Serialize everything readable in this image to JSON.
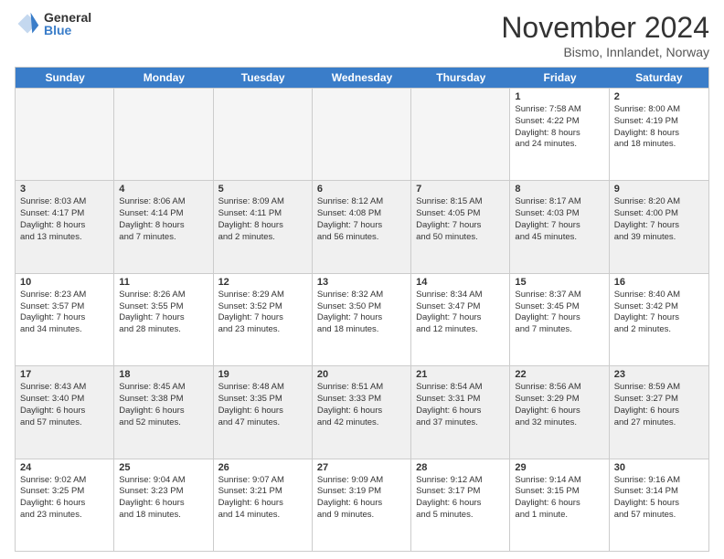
{
  "logo": {
    "general": "General",
    "blue": "Blue"
  },
  "title": "November 2024",
  "location": "Bismo, Innlandet, Norway",
  "days_header": [
    "Sunday",
    "Monday",
    "Tuesday",
    "Wednesday",
    "Thursday",
    "Friday",
    "Saturday"
  ],
  "rows": [
    [
      {
        "day": "",
        "info": "",
        "empty": true
      },
      {
        "day": "",
        "info": "",
        "empty": true
      },
      {
        "day": "",
        "info": "",
        "empty": true
      },
      {
        "day": "",
        "info": "",
        "empty": true
      },
      {
        "day": "",
        "info": "",
        "empty": true
      },
      {
        "day": "1",
        "info": "Sunrise: 7:58 AM\nSunset: 4:22 PM\nDaylight: 8 hours\nand 24 minutes."
      },
      {
        "day": "2",
        "info": "Sunrise: 8:00 AM\nSunset: 4:19 PM\nDaylight: 8 hours\nand 18 minutes."
      }
    ],
    [
      {
        "day": "3",
        "info": "Sunrise: 8:03 AM\nSunset: 4:17 PM\nDaylight: 8 hours\nand 13 minutes."
      },
      {
        "day": "4",
        "info": "Sunrise: 8:06 AM\nSunset: 4:14 PM\nDaylight: 8 hours\nand 7 minutes."
      },
      {
        "day": "5",
        "info": "Sunrise: 8:09 AM\nSunset: 4:11 PM\nDaylight: 8 hours\nand 2 minutes."
      },
      {
        "day": "6",
        "info": "Sunrise: 8:12 AM\nSunset: 4:08 PM\nDaylight: 7 hours\nand 56 minutes."
      },
      {
        "day": "7",
        "info": "Sunrise: 8:15 AM\nSunset: 4:05 PM\nDaylight: 7 hours\nand 50 minutes."
      },
      {
        "day": "8",
        "info": "Sunrise: 8:17 AM\nSunset: 4:03 PM\nDaylight: 7 hours\nand 45 minutes."
      },
      {
        "day": "9",
        "info": "Sunrise: 8:20 AM\nSunset: 4:00 PM\nDaylight: 7 hours\nand 39 minutes."
      }
    ],
    [
      {
        "day": "10",
        "info": "Sunrise: 8:23 AM\nSunset: 3:57 PM\nDaylight: 7 hours\nand 34 minutes."
      },
      {
        "day": "11",
        "info": "Sunrise: 8:26 AM\nSunset: 3:55 PM\nDaylight: 7 hours\nand 28 minutes."
      },
      {
        "day": "12",
        "info": "Sunrise: 8:29 AM\nSunset: 3:52 PM\nDaylight: 7 hours\nand 23 minutes."
      },
      {
        "day": "13",
        "info": "Sunrise: 8:32 AM\nSunset: 3:50 PM\nDaylight: 7 hours\nand 18 minutes."
      },
      {
        "day": "14",
        "info": "Sunrise: 8:34 AM\nSunset: 3:47 PM\nDaylight: 7 hours\nand 12 minutes."
      },
      {
        "day": "15",
        "info": "Sunrise: 8:37 AM\nSunset: 3:45 PM\nDaylight: 7 hours\nand 7 minutes."
      },
      {
        "day": "16",
        "info": "Sunrise: 8:40 AM\nSunset: 3:42 PM\nDaylight: 7 hours\nand 2 minutes."
      }
    ],
    [
      {
        "day": "17",
        "info": "Sunrise: 8:43 AM\nSunset: 3:40 PM\nDaylight: 6 hours\nand 57 minutes."
      },
      {
        "day": "18",
        "info": "Sunrise: 8:45 AM\nSunset: 3:38 PM\nDaylight: 6 hours\nand 52 minutes."
      },
      {
        "day": "19",
        "info": "Sunrise: 8:48 AM\nSunset: 3:35 PM\nDaylight: 6 hours\nand 47 minutes."
      },
      {
        "day": "20",
        "info": "Sunrise: 8:51 AM\nSunset: 3:33 PM\nDaylight: 6 hours\nand 42 minutes."
      },
      {
        "day": "21",
        "info": "Sunrise: 8:54 AM\nSunset: 3:31 PM\nDaylight: 6 hours\nand 37 minutes."
      },
      {
        "day": "22",
        "info": "Sunrise: 8:56 AM\nSunset: 3:29 PM\nDaylight: 6 hours\nand 32 minutes."
      },
      {
        "day": "23",
        "info": "Sunrise: 8:59 AM\nSunset: 3:27 PM\nDaylight: 6 hours\nand 27 minutes."
      }
    ],
    [
      {
        "day": "24",
        "info": "Sunrise: 9:02 AM\nSunset: 3:25 PM\nDaylight: 6 hours\nand 23 minutes."
      },
      {
        "day": "25",
        "info": "Sunrise: 9:04 AM\nSunset: 3:23 PM\nDaylight: 6 hours\nand 18 minutes."
      },
      {
        "day": "26",
        "info": "Sunrise: 9:07 AM\nSunset: 3:21 PM\nDaylight: 6 hours\nand 14 minutes."
      },
      {
        "day": "27",
        "info": "Sunrise: 9:09 AM\nSunset: 3:19 PM\nDaylight: 6 hours\nand 9 minutes."
      },
      {
        "day": "28",
        "info": "Sunrise: 9:12 AM\nSunset: 3:17 PM\nDaylight: 6 hours\nand 5 minutes."
      },
      {
        "day": "29",
        "info": "Sunrise: 9:14 AM\nSunset: 3:15 PM\nDaylight: 6 hours\nand 1 minute."
      },
      {
        "day": "30",
        "info": "Sunrise: 9:16 AM\nSunset: 3:14 PM\nDaylight: 5 hours\nand 57 minutes."
      }
    ]
  ]
}
